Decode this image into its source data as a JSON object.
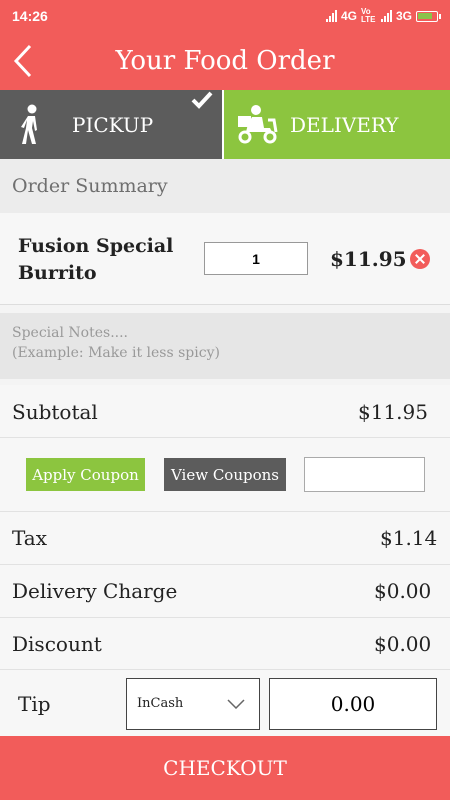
{
  "status_bar": {
    "time": "14:26",
    "network_1": "4G",
    "volte": "Vo LTE",
    "network_2": "3G"
  },
  "header": {
    "title": "Your Food Order"
  },
  "order_mode": {
    "pickup_label": "PICKUP",
    "delivery_label": "DELIVERY",
    "selected": "PICKUP",
    "colors": {
      "pickup": "#5c5c5c",
      "delivery": "#8cc53f"
    }
  },
  "summary": {
    "title": "Order Summary"
  },
  "items": [
    {
      "name": "Fusion Special Burrito",
      "quantity": "1",
      "price": "$11.95"
    }
  ],
  "notes": {
    "placeholder": "Special Notes....\n(Example: Make it less spicy)"
  },
  "subtotal": {
    "label": "Subtotal",
    "value": "$11.95"
  },
  "coupon": {
    "apply_label": "Apply Coupon",
    "view_label": "View Coupons",
    "code_value": ""
  },
  "tax": {
    "label": "Tax",
    "value": "$1.14"
  },
  "delivery_charge": {
    "label": "Delivery Charge",
    "value": "$0.00"
  },
  "discount": {
    "label": "Discount",
    "value": "$0.00"
  },
  "tip": {
    "label": "Tip",
    "method": "InCash",
    "amount": "0.00"
  },
  "checkout": {
    "label": "CHECKOUT"
  },
  "colors": {
    "accent": "#f25c5a",
    "green": "#8cc53f",
    "dark": "#5c5c5c"
  },
  "icons": {
    "back": "back-arrow-icon",
    "pickup": "walking-person-icon",
    "delivery": "delivery-scooter-icon",
    "selected": "checkmark-icon",
    "remove": "remove-icon",
    "dropdown": "chevron-down-icon"
  }
}
